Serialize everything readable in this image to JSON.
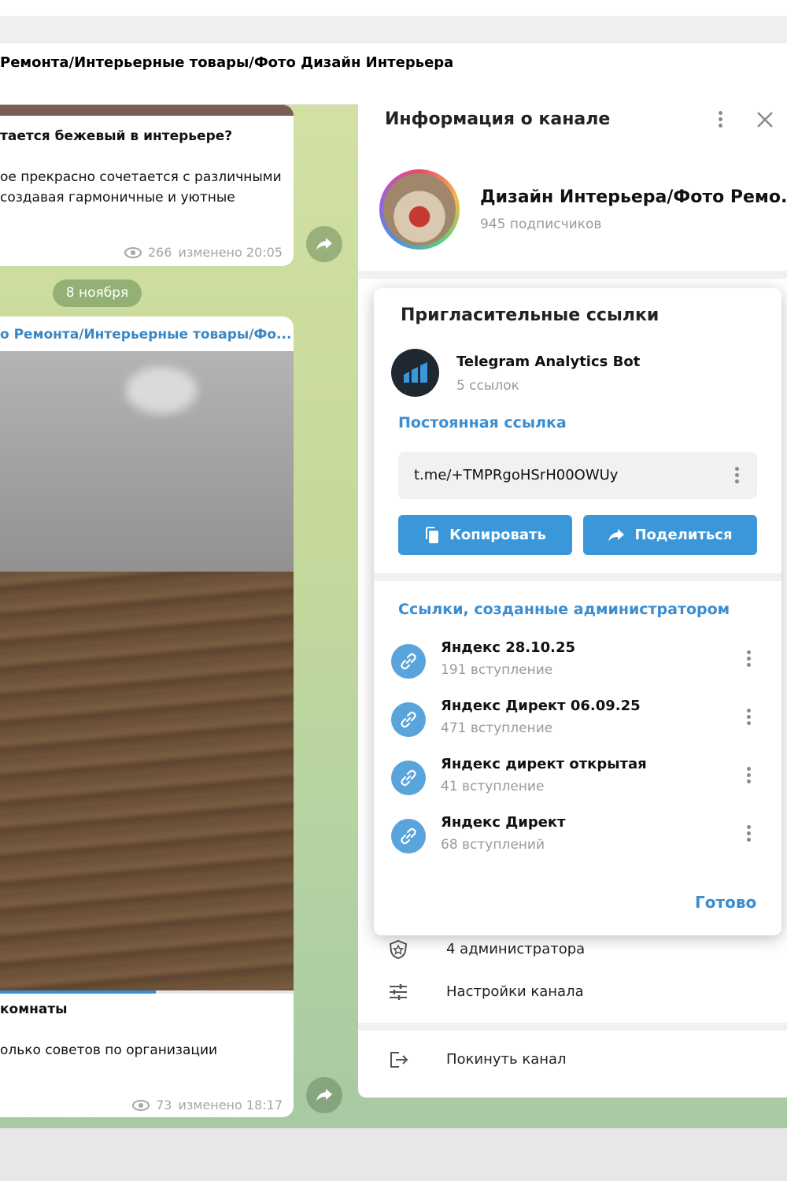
{
  "chat": {
    "title": "Ремонта/Интерьерные товары/Фото Дизайн Интерьера",
    "post1": {
      "heading": "тается бежевый в интерьере?",
      "line1": "ое прекрасно сочетается с различными",
      "line2": "создавая гармоничные и уютные",
      "views": "266",
      "edited": "изменено 20:05"
    },
    "date_pill": "8 ноября",
    "post2": {
      "author": "о Ремонта/Интерьерные товары/Фо...",
      "video_progress": 0.53,
      "heading": "комнаты",
      "line1": "олько советов по организации",
      "views": "73",
      "edited": "изменено 18:17"
    }
  },
  "side_panel": {
    "title": "Информация о канале",
    "channel_name": "Дизайн Интерьера/Фото Ремо...",
    "subscribers": "945 подписчиков",
    "rows": [
      {
        "icon": "shield-star-icon",
        "label": "4 администратора"
      },
      {
        "icon": "sliders-icon",
        "label": "Настройки канала"
      },
      {
        "icon": "leave-icon",
        "label": "Покинуть канал"
      }
    ]
  },
  "modal": {
    "title": "Пригласительные ссылки",
    "bot_name": "Telegram Analytics Bot",
    "bot_links": "5 ссылок",
    "permanent_label": "Постоянная ссылка",
    "permanent_link": "t.me/+TMPRgoHSrH00OWUy",
    "copy_label": "Копировать",
    "share_label": "Поделиться",
    "admin_links_label": "Ссылки, созданные администратором",
    "links": [
      {
        "name": "Яндекс 28.10.25",
        "count": "191 вступление"
      },
      {
        "name": "Яндекс Директ 06.09.25",
        "count": "471 вступление"
      },
      {
        "name": "Яндекс директ открытая",
        "count": "41 вступление"
      },
      {
        "name": "Яндекс Директ",
        "count": "68 вступлений"
      }
    ],
    "done_label": "Готово"
  },
  "colors": {
    "accent": "#3a8dd0",
    "button": "#3a97d9",
    "link_icon_bg": "#5aa4dc"
  }
}
